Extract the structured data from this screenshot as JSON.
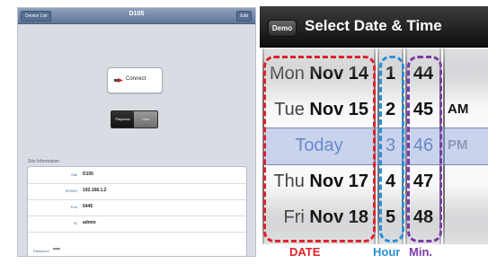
{
  "left_screen": {
    "nav": {
      "back_label": "Device List",
      "title": "D105",
      "edit_label": "Edit"
    },
    "connect_label": "Connect",
    "segment": [
      "Playback",
      "Live"
    ],
    "section_title": "Site Information",
    "info_rows": [
      {
        "key": "Site",
        "value": "D105"
      },
      {
        "key": "IP/DNS",
        "value": "192.168.1.2"
      },
      {
        "key": "Port",
        "value": "5445"
      },
      {
        "key": "ID",
        "value": "admin"
      }
    ],
    "password": {
      "key": "Password",
      "value": "****"
    }
  },
  "right_screen": {
    "nav": {
      "demo_label": "Demo",
      "title": "Select Date & Time"
    },
    "date_wheel": [
      {
        "dow": "Mon",
        "md": "Nov 14"
      },
      {
        "dow": "Tue",
        "md": "Nov 15"
      },
      {
        "label": "Today"
      },
      {
        "dow": "Thu",
        "md": "Nov 17"
      },
      {
        "dow": "Fri",
        "md": "Nov 18"
      }
    ],
    "hour_wheel": [
      "1",
      "2",
      "3",
      "4",
      "5"
    ],
    "minute_wheel": [
      "44",
      "45",
      "46",
      "47",
      "48"
    ],
    "ampm_wheel": [
      "",
      "AM",
      "PM",
      "",
      ""
    ],
    "annotations": [
      {
        "label": "DATE",
        "color": "#e0202a"
      },
      {
        "label": "Hour",
        "color": "#2b8fd6"
      },
      {
        "label": "Min.",
        "color": "#7d3aa6"
      }
    ],
    "colors": {
      "selected_text": "#4d79c5",
      "selection_band": "#8aa0d4"
    }
  }
}
